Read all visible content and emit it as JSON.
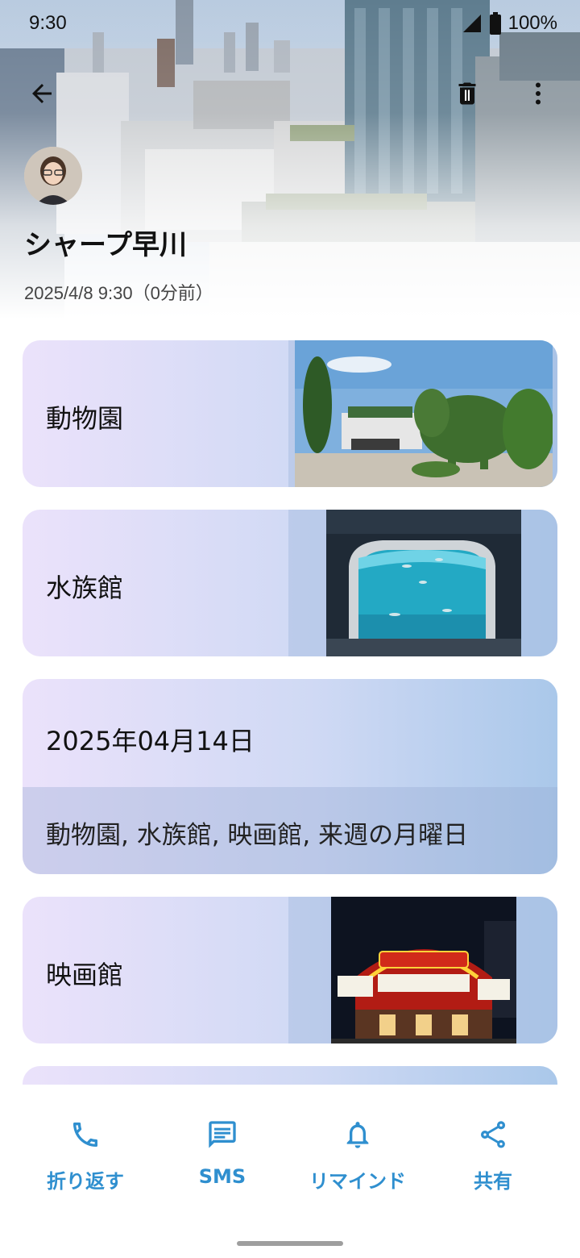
{
  "status_bar": {
    "time": "9:30",
    "battery": "100%"
  },
  "header": {
    "contact_name": "シャープ早川",
    "timestamp": "2025/4/8 9:30（0分前）"
  },
  "icons": {
    "back": "arrow-back-icon",
    "delete": "trash-icon",
    "more": "more-vertical-icon"
  },
  "cards": [
    {
      "label": "動物園",
      "image": "zoo-entrance-photo"
    },
    {
      "label": "水族館",
      "image": "aquarium-tank-photo"
    },
    {
      "label": "映画館",
      "image": "movie-theater-photo"
    }
  ],
  "date_card": {
    "title": "2025年04月14日",
    "items": "動物園, 水族館, 映画館, 来週の月曜日"
  },
  "actions": [
    {
      "label": "折り返す",
      "icon": "phone-icon"
    },
    {
      "label": "SMS",
      "icon": "sms-icon"
    },
    {
      "label": "リマインド",
      "icon": "bell-icon"
    },
    {
      "label": "共有",
      "icon": "share-icon"
    }
  ],
  "colors": {
    "accent": "#2f8fcf",
    "card_start": "#ebe2fb",
    "card_end": "#aac8ea"
  }
}
